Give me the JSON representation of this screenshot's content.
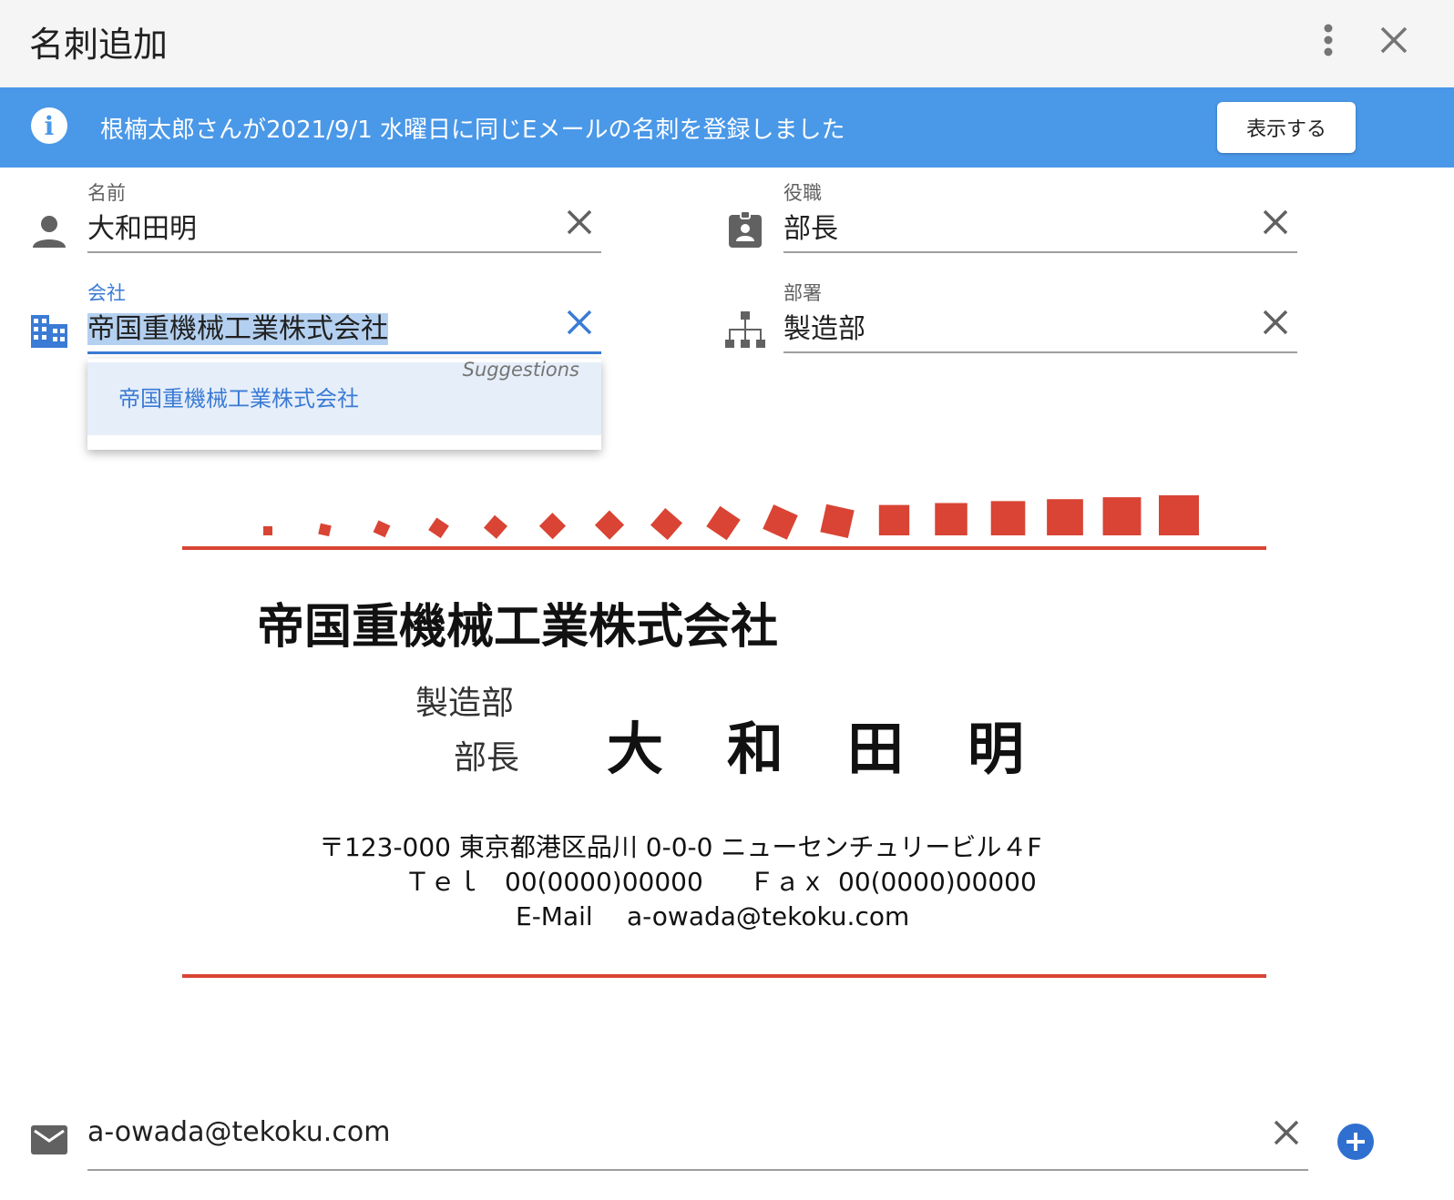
{
  "header": {
    "title": "名刺追加"
  },
  "banner": {
    "message": "根楠太郎さんが2021/9/1 水曜日に同じEメールの名刺を登録しました",
    "button_label": "表示する",
    "icon": "info-icon"
  },
  "fields": {
    "name": {
      "label": "名前",
      "value": "大和田明",
      "icon": "person-icon"
    },
    "title": {
      "label": "役職",
      "value": "部長",
      "icon": "badge-icon"
    },
    "company": {
      "label": "会社",
      "value": "帝国重機械工業株式会社",
      "icon": "building-icon"
    },
    "department": {
      "label": "部署",
      "value": "製造部",
      "icon": "org-chart-icon"
    },
    "email": {
      "value": "a-owada@tekoku.com",
      "icon": "mail-icon"
    }
  },
  "suggestions": {
    "header": "Suggestions",
    "items": [
      "帝国重機械工業株式会社"
    ]
  },
  "card": {
    "company": "帝国重機械工業株式会社",
    "department": "製造部",
    "position": "部長",
    "name_chars": [
      "大",
      "和",
      "田",
      "明"
    ],
    "address": "〒123-000 東京都港区品川 0-0-0 ニューセンチュリービル４F",
    "tel_label": "Ｔｅｌ",
    "tel": "00(0000)00000",
    "fax_label": "Ｆａｘ",
    "fax": "00(0000)00000",
    "email_label": "E-Mail",
    "email": "a-owada@tekoku.com"
  },
  "colors": {
    "accent": "#3a7bd5",
    "banner": "#4a98e8",
    "card_red": "#d94434"
  }
}
